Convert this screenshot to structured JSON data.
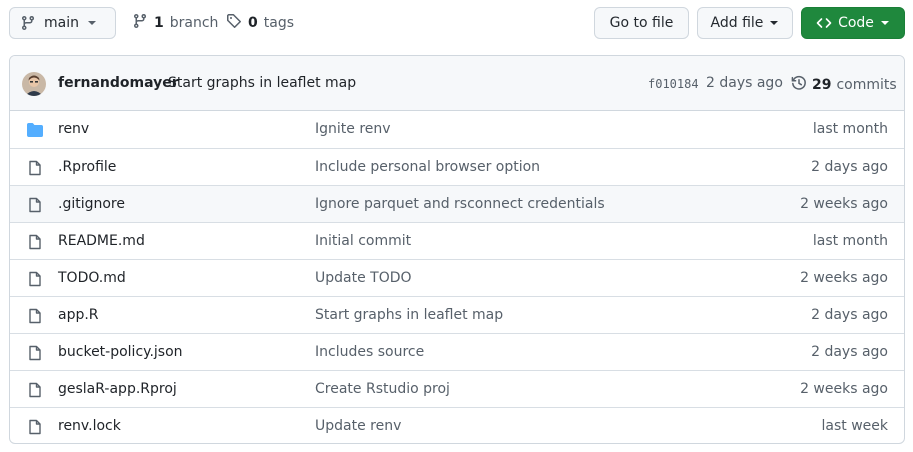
{
  "toolbar": {
    "branch_label": "main",
    "branch_count": "1",
    "branch_word": "branch",
    "tag_count": "0",
    "tag_word": "tags",
    "goto_file_label": "Go to file",
    "add_file_label": "Add file",
    "code_label": "Code"
  },
  "commit": {
    "author": "fernandomayer",
    "message": "Start graphs in leaflet map",
    "sha": "f010184",
    "age": "2 days ago",
    "commit_count": "29",
    "commit_word": "commits"
  },
  "files": [
    {
      "name": "renv",
      "type": "folder",
      "message": "Ignite renv",
      "age": "last month"
    },
    {
      "name": ".Rprofile",
      "type": "file",
      "message": "Include personal browser option",
      "age": "2 days ago"
    },
    {
      "name": ".gitignore",
      "type": "file",
      "message": "Ignore parquet and rsconnect credentials",
      "age": "2 weeks ago"
    },
    {
      "name": "README.md",
      "type": "file",
      "message": "Initial commit",
      "age": "last month"
    },
    {
      "name": "TODO.md",
      "type": "file",
      "message": "Update TODO",
      "age": "2 weeks ago"
    },
    {
      "name": "app.R",
      "type": "file",
      "message": "Start graphs in leaflet map",
      "age": "2 days ago"
    },
    {
      "name": "bucket-policy.json",
      "type": "file",
      "message": "Includes source",
      "age": "2 days ago"
    },
    {
      "name": "geslaR-app.Rproj",
      "type": "file",
      "message": "Create Rstudio proj",
      "age": "2 weeks ago"
    },
    {
      "name": "renv.lock",
      "type": "file",
      "message": "Update renv",
      "age": "last week"
    }
  ],
  "colors": {
    "accent_green": "#1f883d",
    "folder_blue": "#54aeff",
    "muted_text": "#57606a",
    "border": "#d0d7de"
  },
  "icons": {
    "branch": "git-branch-icon",
    "tag": "tag-icon",
    "code": "code-icon",
    "history": "history-icon",
    "folder": "folder-icon",
    "file": "file-icon",
    "caret": "caret-down-icon"
  }
}
